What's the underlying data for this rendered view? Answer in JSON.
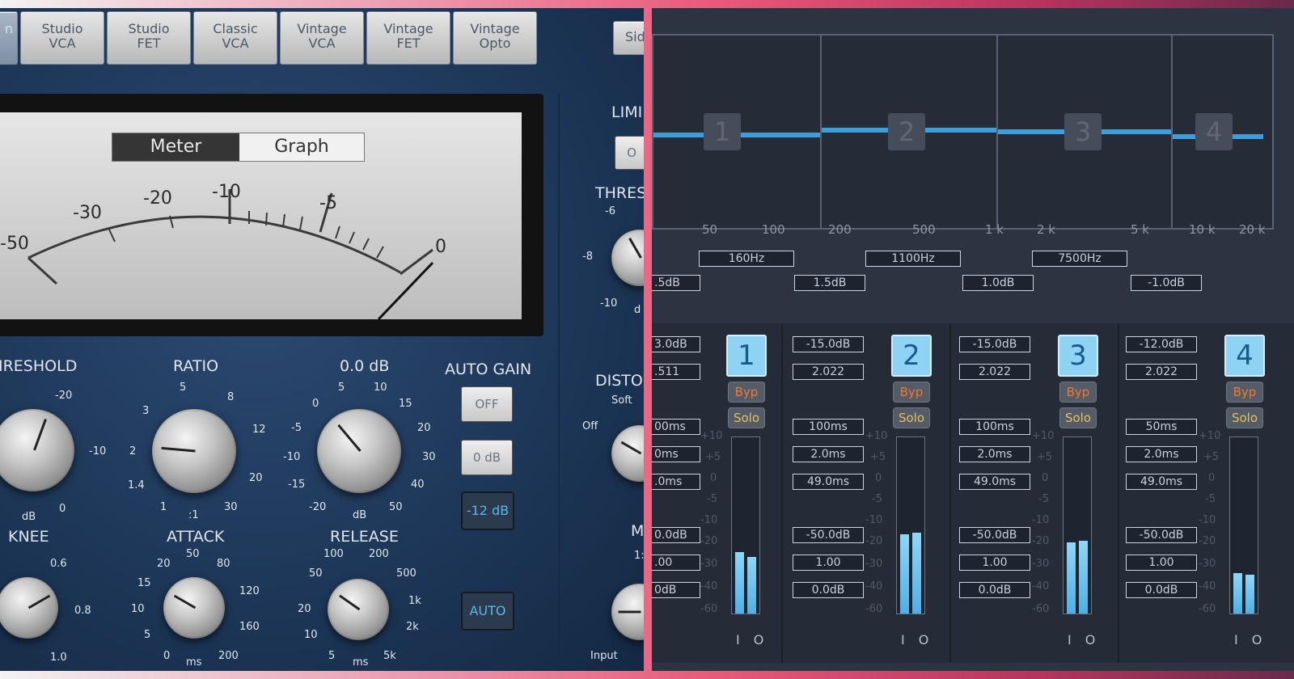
{
  "left_panel": {
    "tabs": [
      {
        "line1": "",
        "line2": "",
        "partial": "n"
      },
      {
        "line1": "Studio",
        "line2": "VCA"
      },
      {
        "line1": "Studio",
        "line2": "FET"
      },
      {
        "line1": "Classic",
        "line2": "VCA"
      },
      {
        "line1": "Vintage",
        "line2": "VCA"
      },
      {
        "line1": "Vintage",
        "line2": "FET"
      },
      {
        "line1": "Vintage",
        "line2": "Opto"
      }
    ],
    "side_tab": "Sid",
    "meter_toggle": {
      "meter": "Meter",
      "graph": "Graph",
      "selected": "Meter"
    },
    "meter_scale": [
      "-50",
      "-30",
      "-20",
      "-10",
      "-5",
      "0"
    ],
    "knobs": {
      "threshold": {
        "label": "IRESHOLD",
        "ticks": [
          "-20",
          "-10",
          "0",
          "dB"
        ]
      },
      "ratio": {
        "label": "RATIO",
        "ticks": [
          "5",
          "8",
          "3",
          "12",
          "2",
          "20",
          "1.4",
          "1",
          "30",
          ":1"
        ]
      },
      "gain": {
        "label": "0.0 dB",
        "ticks": [
          "5",
          "10",
          "0",
          "15",
          "-5",
          "20",
          "-10",
          "30",
          "-15",
          "40",
          "-20",
          "50",
          "dB"
        ]
      },
      "knee": {
        "label": "KNEE",
        "ticks": [
          "0.6",
          "0.8",
          "1.0"
        ]
      },
      "attack": {
        "label": "ATTACK",
        "ticks": [
          "50",
          "20",
          "80",
          "15",
          "120",
          "10",
          "160",
          "5",
          "0",
          "200",
          "ms"
        ]
      },
      "release": {
        "label": "RELEASE",
        "ticks": [
          "100",
          "200",
          "50",
          "500",
          "20",
          "1k",
          "10",
          "2k",
          "5",
          "5k",
          "ms"
        ]
      }
    },
    "auto_gain": {
      "label": "AUTO GAIN",
      "options": [
        "OFF",
        "0 dB",
        "-12 dB"
      ],
      "selected": "-12 dB"
    },
    "auto_button": "AUTO",
    "right_partial": {
      "limiter": "LIMI",
      "limiter_btn": "O",
      "threshold": "THRES",
      "thres_ticks": [
        "-6",
        "-8",
        "-10",
        "d"
      ],
      "distortion": "DISTO",
      "soft": "Soft",
      "off": "Off",
      "mix": "M",
      "mix_tick": "1:",
      "input": "Input"
    }
  },
  "right_panel": {
    "band_numbers_graph": [
      "1",
      "2",
      "3",
      "4"
    ],
    "freq_axis": [
      "50",
      "100",
      "200",
      "500",
      "1 k",
      "2 k",
      "5 k",
      "10 k",
      "20 k"
    ],
    "crossovers": [
      "160Hz",
      "1100Hz",
      "7500Hz"
    ],
    "band_gains": [
      ".5dB",
      "1.5dB",
      "1.0dB",
      "-1.0dB"
    ],
    "bands": [
      {
        "num": "1",
        "threshold": "3.0dB",
        "ratio": ".511",
        "attack": "00ms",
        "release": "0ms",
        "lookahead": ".0ms",
        "range": "0.0dB",
        "knee": ".00",
        "makeup": "0dB",
        "meter": [
          0.36,
          0.34
        ]
      },
      {
        "num": "2",
        "threshold": "-15.0dB",
        "ratio": "2.022",
        "attack": "100ms",
        "release": "2.0ms",
        "lookahead": "49.0ms",
        "range": "-50.0dB",
        "knee": "1.00",
        "makeup": "0.0dB",
        "meter": [
          0.45,
          0.46
        ]
      },
      {
        "num": "3",
        "threshold": "-15.0dB",
        "ratio": "2.022",
        "attack": "100ms",
        "release": "2.0ms",
        "lookahead": "49.0ms",
        "range": "-50.0dB",
        "knee": "1.00",
        "makeup": "0.0dB",
        "meter": [
          0.4,
          0.41
        ]
      },
      {
        "num": "4",
        "threshold": "-12.0dB",
        "ratio": "2.022",
        "attack": "50ms",
        "release": "2.0ms",
        "lookahead": "49.0ms",
        "range": "-50.0dB",
        "knee": "1.00",
        "makeup": "0.0dB",
        "meter": [
          0.23,
          0.22
        ]
      }
    ],
    "byp": "Byp",
    "solo": "Solo",
    "io": "I O",
    "meter_scale": [
      "+10",
      "+5",
      "0",
      "-5",
      "-10",
      "-20",
      "-30",
      "-40",
      "-60"
    ]
  }
}
